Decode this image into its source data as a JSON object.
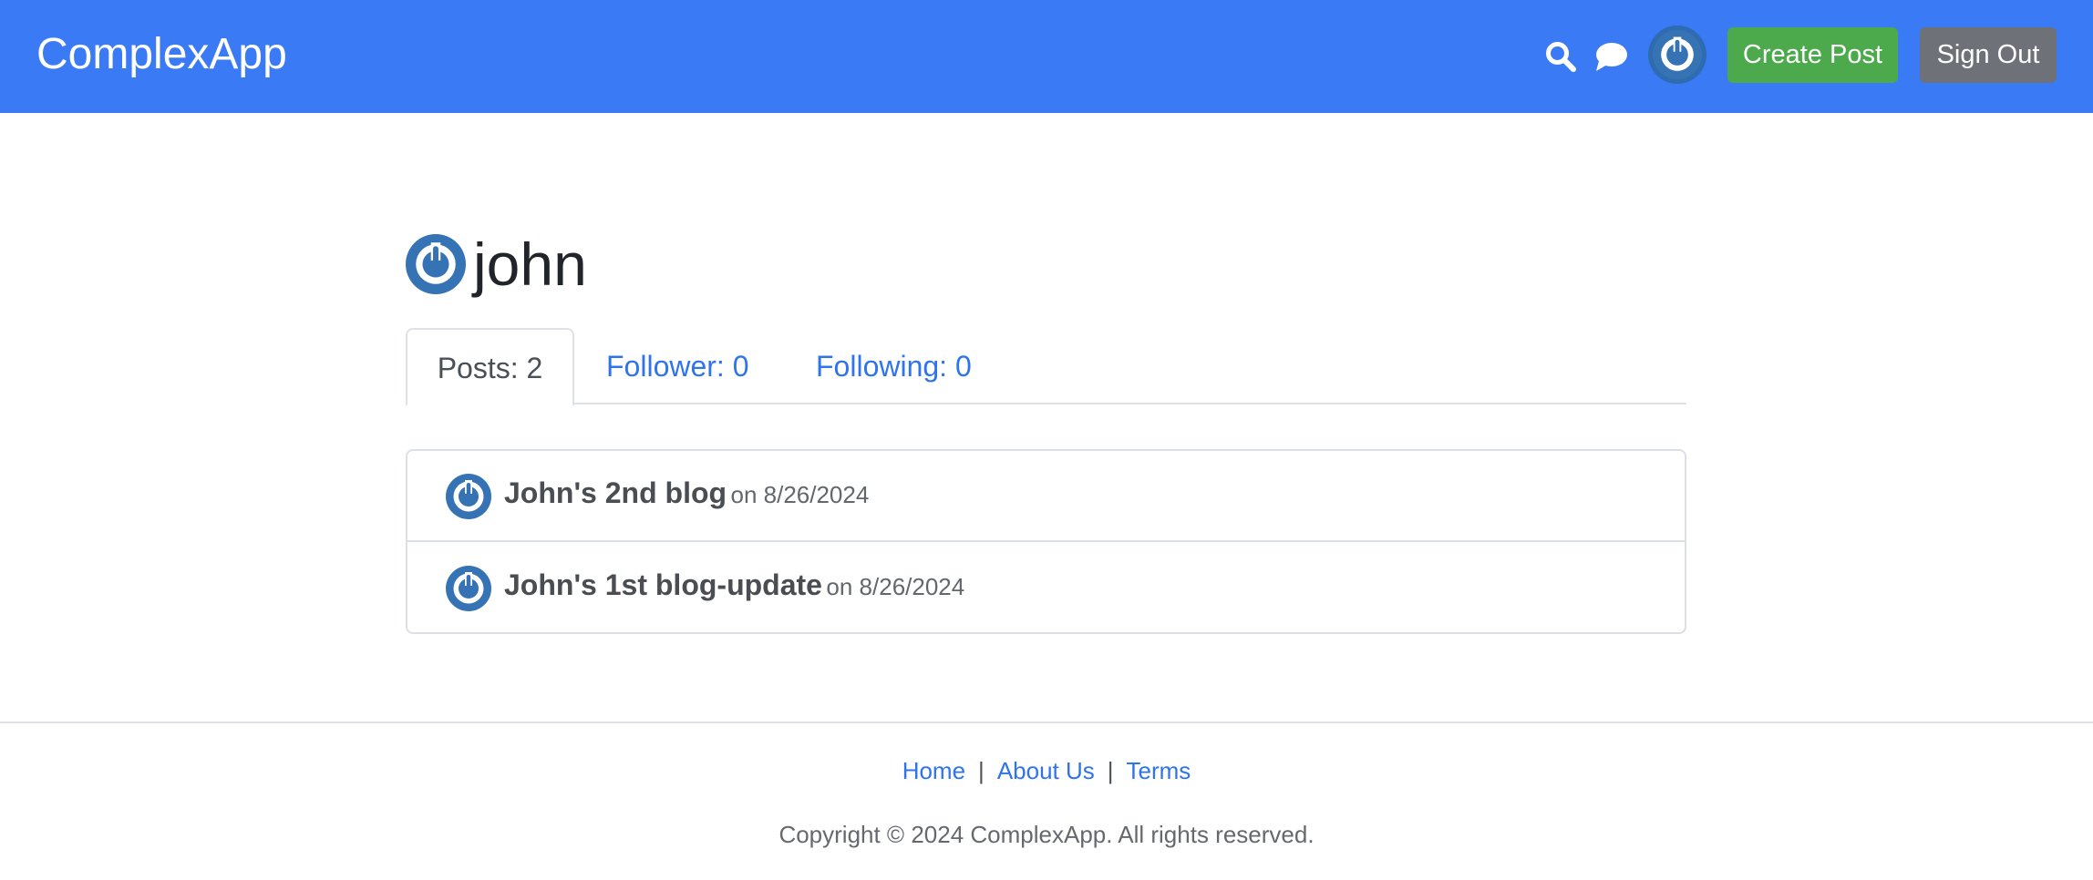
{
  "header": {
    "brand": "ComplexApp",
    "create_post_label": "Create Post",
    "sign_out_label": "Sign Out",
    "icons": [
      "search-icon",
      "chat-icon",
      "avatar"
    ]
  },
  "profile": {
    "username": "john"
  },
  "tabs": {
    "posts": "Posts: 2",
    "followers": "Follower: 0",
    "following": "Following: 0"
  },
  "posts": [
    {
      "title": "John's 2nd blog",
      "date": "on 8/26/2024"
    },
    {
      "title": "John's 1st blog-update",
      "date": "on 8/26/2024"
    }
  ],
  "footer": {
    "links": [
      "Home",
      "About Us",
      "Terms"
    ],
    "separator": "|",
    "copyright": "Copyright © 2024 ComplexApp. All rights reserved."
  },
  "colors": {
    "header_bg": "#3a7bf5",
    "create_btn": "#4caa4c",
    "signout_btn": "#6e7278",
    "link": "#2f74ec",
    "avatar_blue": "#3673b5"
  }
}
